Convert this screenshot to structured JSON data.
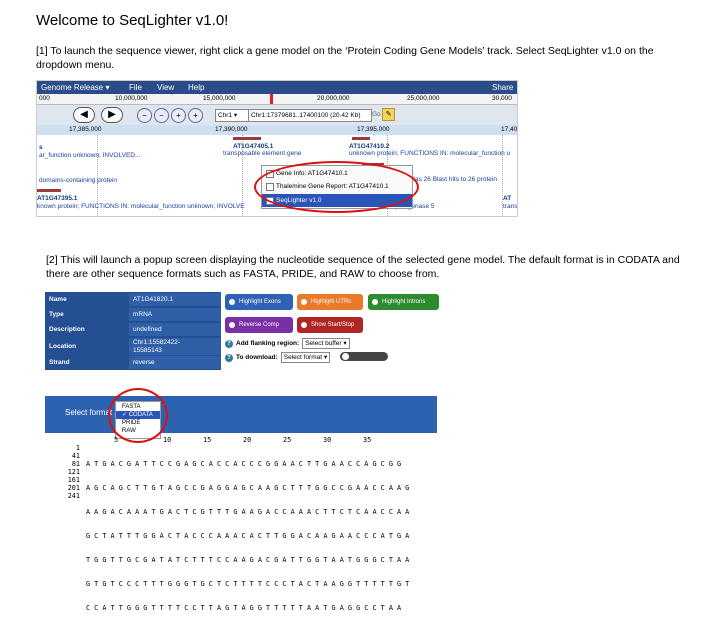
{
  "title": "Welcome to SeqLighter v1.0!",
  "instruction1": "[1] To launch the sequence viewer, right click a gene model on the ‘Protein Coding Gene Models’ track. Select SeqLighter v1.0 on the dropdown menu.",
  "instruction2": "[2] This will launch a popup screen displaying the nucleotide sequence of the selected gene model. The default format is in CODATA and there are other sequence formats such as FASTA, PRIDE, and RAW to choose from.",
  "browser": {
    "menu": [
      "Genome Release ▾",
      "File",
      "View",
      "Help"
    ],
    "menu_right": "Share",
    "scale_top": [
      "000",
      "10,000,000",
      "15,000,000",
      "20,000,000",
      "25,000,000",
      "30,000"
    ],
    "chrom": "Chr1 ▾",
    "location": "Chr1:17379681..17400100 (20.42 Kb)",
    "go": "Go",
    "scale_detail": [
      "17,385,000",
      "17,390,000",
      "17,395,000",
      "17,400"
    ],
    "genes": {
      "g1_id": "AT1G47405.1",
      "g1_desc": "transposable element gene",
      "g2_id": "AT1G47410.2",
      "g2_desc": "unknown protein; FUNCTIONS IN: molecular_function u",
      "g3_id": "AT1G47410.1",
      "g3_desc": "own protein; Has 26 Blast hits to 26 protein",
      "g4_id": "AT1G47420.1",
      "g4_desc": "succinate dehydrogenase 5",
      "left1": "s",
      "left2": "ar_function unknown; INVOLVED...",
      "left3": "domains-containing protein",
      "left4": "AT1G47395.1",
      "left5": "known protein; FUNCTIONS IN: molecular_function unknown; INVOLVE",
      "right1": "AT",
      "right2": "trans"
    },
    "context_menu": [
      "Gene Info: AT1G47410.1",
      "Thalemine Gene Report: AT1G47410.1",
      "SeqLighter v1.0"
    ]
  },
  "info": {
    "rows": [
      {
        "label": "Name",
        "value": "AT1G41820.1"
      },
      {
        "label": "Type",
        "value": "mRNA"
      },
      {
        "label": "Description",
        "value": "undefined"
      },
      {
        "label": "Location",
        "value": "Chr1:15582422-15585143"
      },
      {
        "label": "Strand",
        "value": "reverse"
      }
    ]
  },
  "buttons": {
    "highlight_exons": "Highlight Exons",
    "highlight_utrs": "Highlight UTRs",
    "highlight_introns": "Highlight Introns",
    "reverse_comp": "Reverse Comp",
    "show_start_stop": "Show Start/Stop",
    "colors": {
      "exons": "#2f62b5",
      "utrs": "#e87a2a",
      "introns": "#2e8a2e",
      "reverse": "#7a2fa6",
      "startstop": "#b02626"
    }
  },
  "options": {
    "flank_label": "Add flanking region:",
    "flank_value": "Select buffer ▾",
    "download_label": "To download:",
    "download_value": "Select format ▾"
  },
  "sequence": {
    "format_label": "Select format",
    "formats": [
      "FASTA",
      "✓ CODATA",
      "PRIDE",
      "RAW"
    ],
    "ruler": [
      "5",
      "10",
      "15",
      "20",
      "25",
      "30",
      "35"
    ],
    "lines": [
      {
        "num": "1",
        "seq": "A T G A C G A T T C C G A G C A C C A C C C G G A A C T T G A A C C A G C G G"
      },
      {
        "num": "41",
        "seq": "A G C A G C T T G T A G C C G A G G A G C A A G C T T T G G C C G A A C C A A G"
      },
      {
        "num": "81",
        "seq": "A A G A C A A A T G A C T C G T T T G A A G A C C A A A C T T C T C A A C C A A"
      },
      {
        "num": "121",
        "seq": "G C T A T T T G G A C T A C C C A A A C A C T T G G A C A A G A A C C C A T G A"
      },
      {
        "num": "161",
        "seq": "T G G T T G C G A T A T C T T T C C A A G A C G A T T G G T A A T G G G C T A A"
      },
      {
        "num": "201",
        "seq": "G T G T C C C T T T G G G T G C T C T T T T C C C T A C T A A G G T T T T T G T"
      },
      {
        "num": "241",
        "seq": "C C A T T G G G T T T T C C T T A G T A G G T T T T T A A T G A G G C C T A A"
      }
    ]
  }
}
